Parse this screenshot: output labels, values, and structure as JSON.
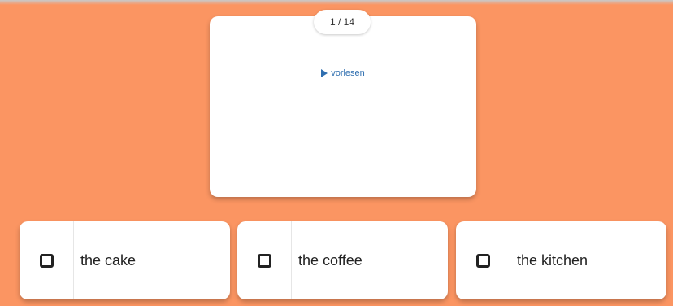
{
  "card": {
    "counter": "1 / 14",
    "read_aloud_label": "vorlesen"
  },
  "answers": [
    {
      "label": "the cake"
    },
    {
      "label": "the coffee"
    },
    {
      "label": "the kitchen"
    }
  ],
  "colors": {
    "background": "#fb9562",
    "link": "#2f6fb0",
    "card": "#ffffff"
  }
}
